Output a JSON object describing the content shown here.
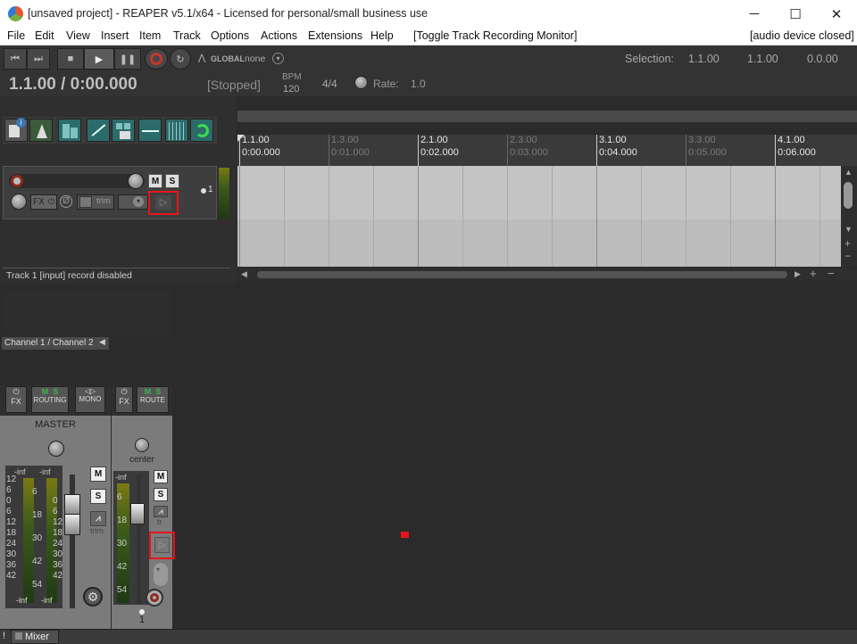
{
  "titlebar": {
    "title": "[unsaved project] - REAPER v5.1/x64 - Licensed for personal/small business use",
    "minimize": "─",
    "maximize": "☐",
    "close": "✕"
  },
  "menu": {
    "items": [
      "File",
      "Edit",
      "View",
      "Insert",
      "Item",
      "Track",
      "Options",
      "Actions",
      "Extensions",
      "Help",
      "[Toggle Track Recording Monitor]"
    ],
    "right_status": "[audio device closed]"
  },
  "transport": {
    "global_label": "GLOBAL",
    "global_value": "none",
    "selection_label": "Selection:",
    "selection_start": "1.1.00",
    "selection_end": "1.1.00",
    "selection_length": "0.0.00",
    "position": "1.1.00 / 0:00.000",
    "state": "[Stopped]",
    "bpm_label": "BPM",
    "bpm_value": "120",
    "time_sig": "4/4",
    "rate_label": "Rate:",
    "rate_value": "1.0"
  },
  "track": {
    "mute": "M",
    "solo": "S",
    "fx": "FX",
    "trim": "trim",
    "number": "1",
    "status": "Track 1 [input] record disabled",
    "input": "Channel 1 / Channel 2"
  },
  "ruler": {
    "marks": [
      {
        "bar": "1.1.00",
        "time": "0:00.000",
        "major": true
      },
      {
        "bar": "1.3.00",
        "time": "0:01.000",
        "major": false
      },
      {
        "bar": "2.1.00",
        "time": "0:02.000",
        "major": true
      },
      {
        "bar": "2.3.00",
        "time": "0:03.000",
        "major": false
      },
      {
        "bar": "3.1.00",
        "time": "0:04.000",
        "major": true
      },
      {
        "bar": "3.3.00",
        "time": "0:05.000",
        "major": false
      },
      {
        "bar": "4.1.00",
        "time": "0:06.000",
        "major": true
      }
    ]
  },
  "mixer": {
    "master": {
      "fx": "FX",
      "routing": "ROUTING",
      "mono": "MONO",
      "label": "MASTER",
      "mute": "M",
      "solo": "S",
      "trim": "trim",
      "peak_l": "-inf",
      "peak_r": "-inf",
      "bottom_l": "-inf",
      "bottom_r": "-inf",
      "scale_left": [
        "12",
        "6",
        "0",
        "6",
        "12",
        "18",
        "24",
        "30",
        "36",
        "42"
      ],
      "scale_mid": [
        "6",
        "18",
        "30",
        "42",
        "54"
      ],
      "scale_right": [
        "0",
        "6",
        "12",
        "18",
        "24",
        "30",
        "36",
        "42"
      ]
    },
    "track1": {
      "fx": "FX",
      "route": "ROUTE",
      "pan": "center",
      "mute": "M",
      "solo": "S",
      "trim": "tr",
      "peak": "-inf",
      "scale": [
        "6",
        "18",
        "30",
        "42",
        "54"
      ],
      "number": "1"
    },
    "ms_letters": {
      "m": "M",
      "s": "S"
    }
  },
  "bottom_tab": {
    "label": "Mixer",
    "indicator": "!"
  }
}
